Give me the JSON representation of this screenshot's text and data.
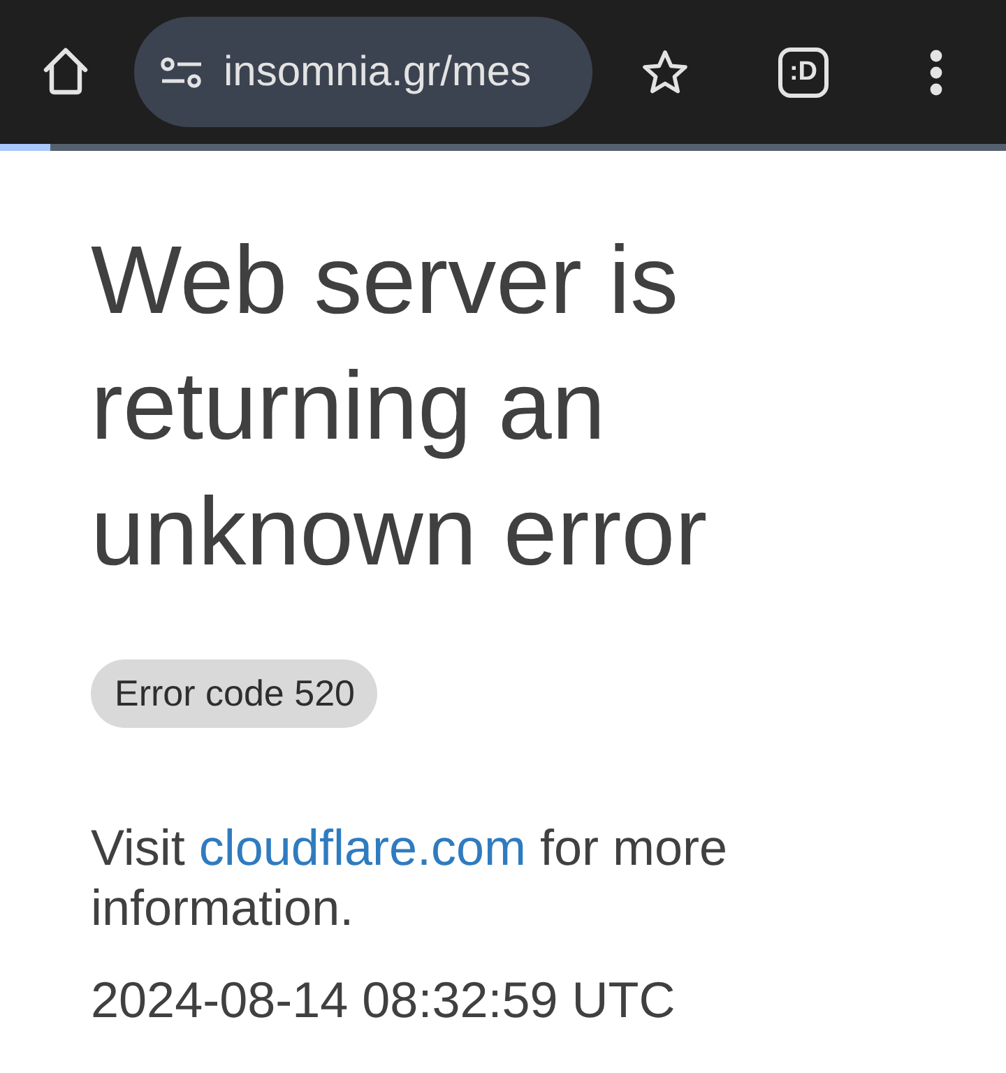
{
  "toolbar": {
    "url": "insomnia.gr/mes",
    "tab_switcher": ":D",
    "progress": {
      "level": 0.05
    }
  },
  "page": {
    "title": "Web server is returning an unknown error",
    "error_code": "Error code 520",
    "message": {
      "before": "Visit ",
      "link": "cloudflare.com",
      "after": " for more information."
    },
    "timestamp": "2024-08-14 08:32:59 UTC"
  }
}
